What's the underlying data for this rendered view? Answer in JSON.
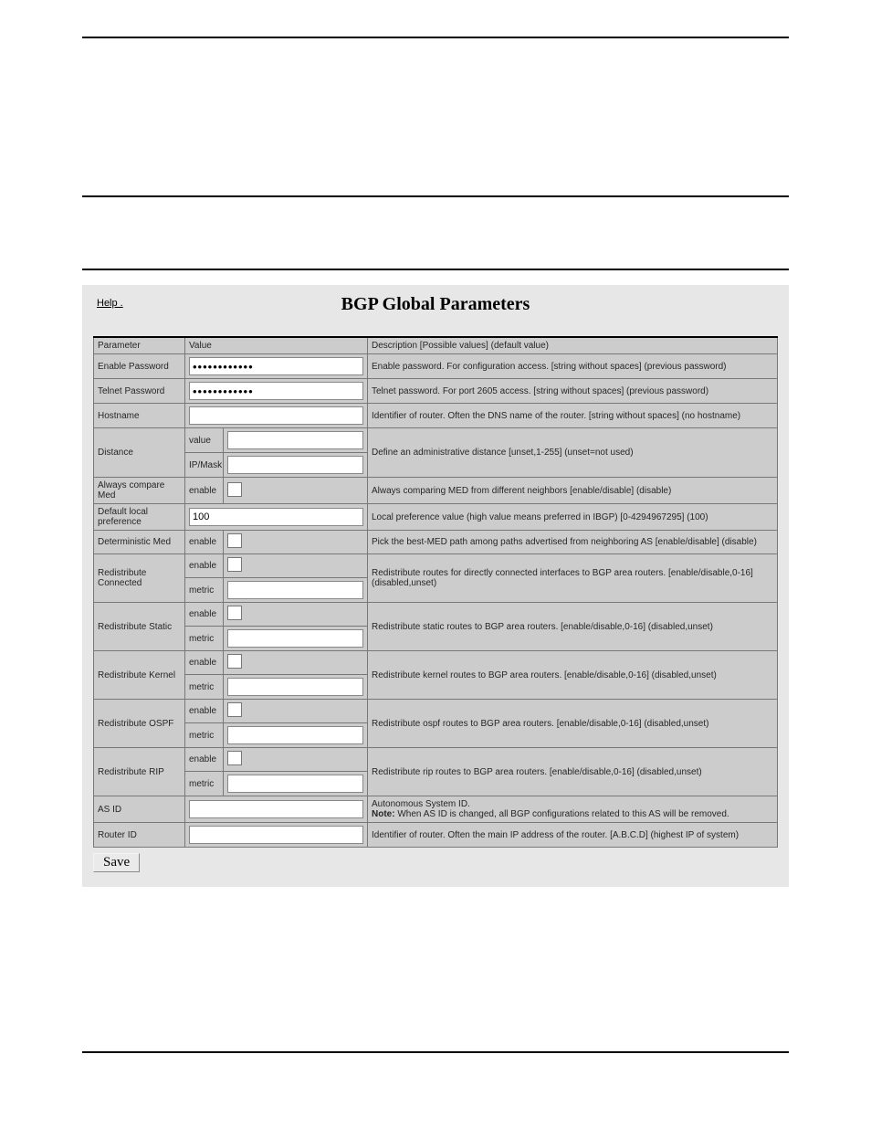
{
  "help_link": "Help .",
  "title": "BGP Global Parameters",
  "table": {
    "headers": {
      "parameter": "Parameter",
      "value": "Value",
      "description": "Description [Possible values] (default value)"
    },
    "sublabels": {
      "value": "value",
      "ipmask": "IP/Mask",
      "enable": "enable",
      "metric": "metric"
    },
    "rows": {
      "enable_password": {
        "label": "Enable Password",
        "value": "************",
        "desc": "Enable password. For configuration access. [string without spaces] (previous password)"
      },
      "telnet_password": {
        "label": "Telnet Password",
        "value": "************",
        "desc": "Telnet password. For port 2605 access. [string without spaces] (previous password)"
      },
      "hostname": {
        "label": "Hostname",
        "value": "",
        "desc": "Identifier of router. Often the DNS name of the router. [string without spaces] (no hostname)"
      },
      "distance": {
        "label": "Distance",
        "value": "",
        "ipmask": "",
        "desc": "Define an administrative distance [unset,1-255] (unset=not used)"
      },
      "always_compare_med": {
        "label": "Always compare Med",
        "desc": "Always comparing MED from different neighbors [enable/disable] (disable)"
      },
      "default_local_pref": {
        "label": "Default local preference",
        "value": "100",
        "desc": "Local preference value (high value means preferred in IBGP) [0-4294967295] (100)"
      },
      "deterministic_med": {
        "label": "Deterministic Med",
        "desc": "Pick the best-MED path among paths advertised from neighboring AS [enable/disable] (disable)"
      },
      "redist_connected": {
        "label": "Redistribute Connected",
        "metric": "",
        "desc": "Redistribute routes for directly connected interfaces to BGP area routers. [enable/disable,0-16] (disabled,unset)"
      },
      "redist_static": {
        "label": "Redistribute Static",
        "metric": "",
        "desc": "Redistribute static routes to BGP area routers. [enable/disable,0-16] (disabled,unset)"
      },
      "redist_kernel": {
        "label": "Redistribute Kernel",
        "metric": "",
        "desc": "Redistribute kernel routes to BGP area routers. [enable/disable,0-16] (disabled,unset)"
      },
      "redist_ospf": {
        "label": "Redistribute OSPF",
        "metric": "",
        "desc": "Redistribute ospf routes to BGP area routers. [enable/disable,0-16] (disabled,unset)"
      },
      "redist_rip": {
        "label": "Redistribute RIP",
        "metric": "",
        "desc": "Redistribute rip routes to BGP area routers. [enable/disable,0-16] (disabled,unset)"
      },
      "as_id": {
        "label": "AS ID",
        "value": "",
        "desc_pre": "Autonomous System ID.",
        "desc_bold": "Note:",
        "desc_post": " When AS ID is changed, all BGP configurations related to this AS will be removed."
      },
      "router_id": {
        "label": "Router ID",
        "value": "",
        "desc": "Identifier of router. Often the main IP address of the router. [A.B.C.D] (highest IP of system)"
      }
    }
  },
  "save_button": "Save"
}
